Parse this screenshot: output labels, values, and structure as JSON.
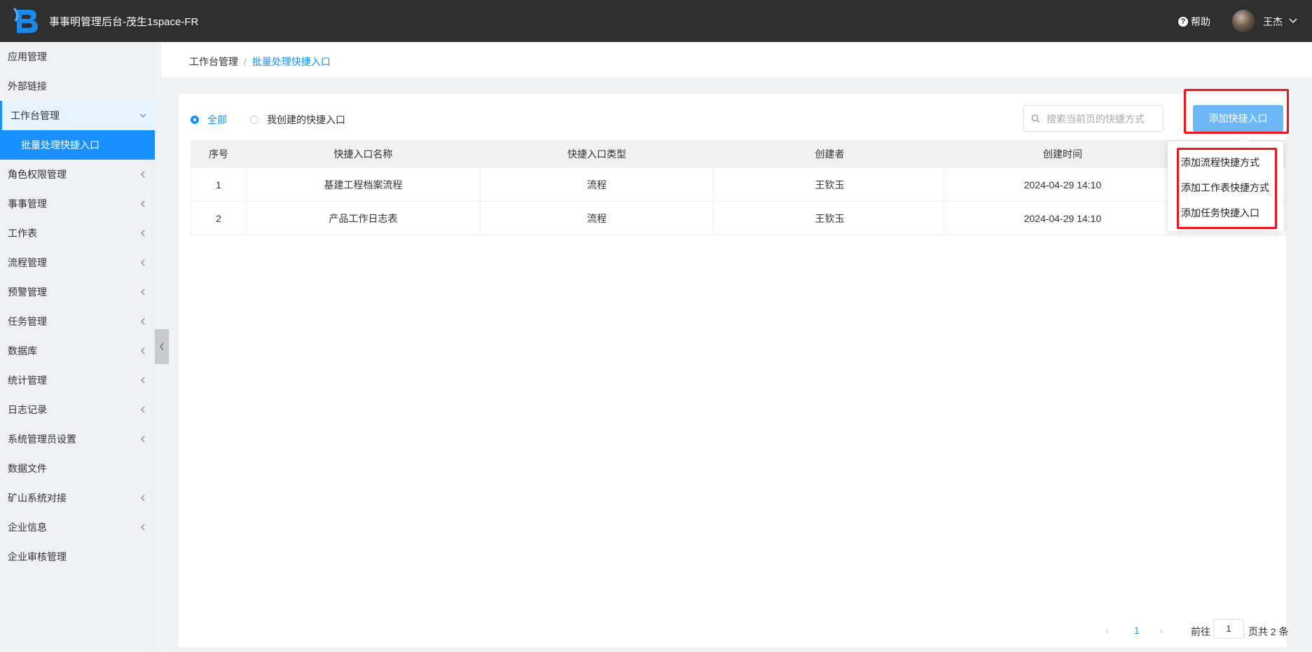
{
  "header": {
    "app_title": "事事明管理后台-茂生1space-FR",
    "help_label": "帮助",
    "username": "王杰"
  },
  "sidebar": {
    "items": [
      {
        "label": "应用管理"
      },
      {
        "label": "外部链接"
      },
      {
        "label": "工作台管理"
      },
      {
        "label": "批量处理快捷入口"
      },
      {
        "label": "角色权限管理"
      },
      {
        "label": "事事管理"
      },
      {
        "label": "工作表"
      },
      {
        "label": "流程管理"
      },
      {
        "label": "预警管理"
      },
      {
        "label": "任务管理"
      },
      {
        "label": "数据库"
      },
      {
        "label": "统计管理"
      },
      {
        "label": "日志记录"
      },
      {
        "label": "系统管理员设置"
      },
      {
        "label": "数据文件"
      },
      {
        "label": "矿山系统对接"
      },
      {
        "label": "企业信息"
      },
      {
        "label": "企业审核管理"
      }
    ]
  },
  "breadcrumb": {
    "parent": "工作台管理",
    "separator": "/",
    "current": "批量处理快捷入口"
  },
  "filters": {
    "all_label": "全部",
    "mine_label": "我创建的快捷入口",
    "selected": "全部"
  },
  "search": {
    "placeholder": "搜索当前页的快捷方式",
    "value": ""
  },
  "add_button_label": "添加快捷入口",
  "table": {
    "headers": [
      "序号",
      "快捷入口名称",
      "快捷入口类型",
      "创建者",
      "创建时间",
      ""
    ],
    "rows": [
      [
        "1",
        "基建工程档案流程",
        "流程",
        "王钦玉",
        "2024-04-29 14:10",
        ""
      ],
      [
        "2",
        "产品工作日志表",
        "流程",
        "王钦玉",
        "2024-04-29 14:10",
        ""
      ]
    ]
  },
  "dropdown": {
    "items": [
      "添加流程快捷方式",
      "添加工作表快捷方式",
      "添加任务快捷入口"
    ]
  },
  "pagination": {
    "prev": "‹",
    "current_page": "1",
    "next": "›",
    "goto_label": "前往",
    "goto_value": "1",
    "total_label": "页共 2 条"
  },
  "colors": {
    "topbar": "#2f2f2f",
    "accent": "#1890ff",
    "add_button": "#6db8f7",
    "highlight": "#f0141a"
  }
}
